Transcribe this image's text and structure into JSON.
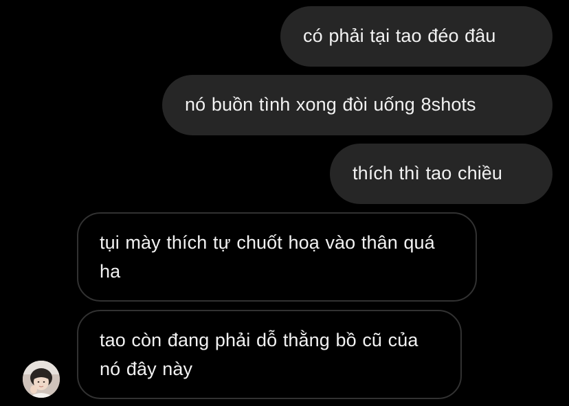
{
  "conversation": {
    "outgoing": [
      {
        "text": "có phải tại tao đéo đâu"
      },
      {
        "text": "nó buồn tình xong đòi uống 8shots"
      },
      {
        "text": "thích thì tao chiều"
      }
    ],
    "incoming": [
      {
        "text": "tụi mày thích tự chuốt hoạ vào thân quá ha"
      },
      {
        "text": "tao còn đang phải dỗ thằng bồ cũ của nó đây này"
      }
    ],
    "sender_avatar": {
      "icon": "contact-avatar-photo"
    }
  },
  "colors": {
    "background": "#000000",
    "outgoing_bubble": "#262626",
    "incoming_border": "#323232",
    "text": "#f2f2f2"
  }
}
